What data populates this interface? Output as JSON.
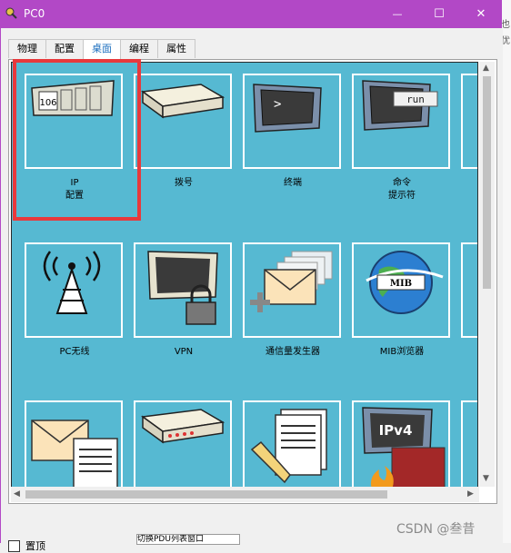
{
  "window": {
    "title": "PC0",
    "minimize_glyph": "—",
    "maximize_glyph": "☐",
    "close_glyph": "✕",
    "accent_color": "#b248c6"
  },
  "tabs": [
    {
      "label": "物理"
    },
    {
      "label": "配置"
    },
    {
      "label": "桌面"
    },
    {
      "label": "编程"
    },
    {
      "label": "属性"
    }
  ],
  "active_tab": "桌面",
  "desktop": {
    "background": "#56b9d2",
    "apps": [
      {
        "label1": "IP",
        "label2": "配置",
        "icon": "ip-config-icon",
        "display": "106"
      },
      {
        "label1": "拨号",
        "label2": "",
        "icon": "dialer-icon"
      },
      {
        "label1": "终端",
        "label2": "",
        "icon": "terminal-icon",
        "display": ">"
      },
      {
        "label1": "命令",
        "label2": "提示符",
        "icon": "command-prompt-icon",
        "display": "run"
      },
      {
        "label1": "PC无线",
        "label2": "",
        "icon": "wireless-icon"
      },
      {
        "label1": "VPN",
        "label2": "",
        "icon": "vpn-icon"
      },
      {
        "label1": "通信量发生器",
        "label2": "",
        "icon": "traffic-generator-icon"
      },
      {
        "label1": "MIB浏览器",
        "label2": "",
        "icon": "mib-browser-icon",
        "display": "MIB"
      },
      {
        "label1": "",
        "label2": "",
        "icon": "email-icon"
      },
      {
        "label1": "",
        "label2": "",
        "icon": "pppoe-dialer-icon"
      },
      {
        "label1": "",
        "label2": "",
        "icon": "text-editor-icon"
      },
      {
        "label1": "",
        "label2": "",
        "icon": "firewall-icon",
        "display": "IPv4"
      }
    ]
  },
  "pin_checkbox": {
    "label": "置顶",
    "checked": false
  },
  "background_window": {
    "side_text": [
      "也",
      "优"
    ],
    "bottom_text": "切换PDU列表窗口"
  },
  "watermark": "CSDN @叁昔"
}
